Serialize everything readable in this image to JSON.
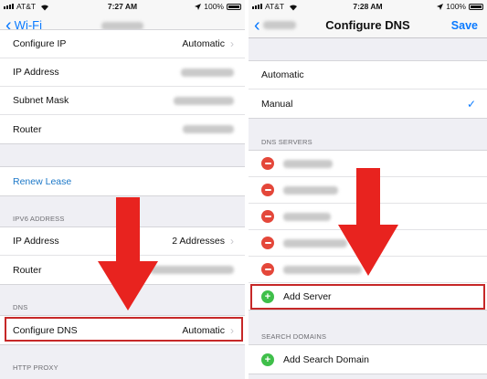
{
  "left": {
    "status": {
      "carrier": "AT&T",
      "time": "7:27 AM",
      "battery": "100%"
    },
    "nav": {
      "back_label": "Wi-Fi"
    },
    "rows_top": [
      {
        "label": "Configure IP",
        "value": "Automatic",
        "chevron": "›"
      },
      {
        "label": "IP Address"
      },
      {
        "label": "Subnet Mask"
      },
      {
        "label": "Router"
      }
    ],
    "renew": {
      "label": "Renew Lease"
    },
    "ipv6": {
      "header": "IPV6 ADDRESS",
      "rows": [
        {
          "label": "IP Address",
          "value": "2 Addresses",
          "chevron": "›"
        },
        {
          "label": "Router"
        }
      ]
    },
    "dns": {
      "header": "DNS",
      "row": {
        "label": "Configure DNS",
        "value": "Automatic",
        "chevron": "›"
      }
    },
    "proxy": {
      "header": "HTTP PROXY"
    }
  },
  "right": {
    "status": {
      "carrier": "AT&T",
      "time": "7:28 AM",
      "battery": "100%"
    },
    "nav": {
      "title": "Configure DNS",
      "save_label": "Save"
    },
    "modes": [
      {
        "label": "Automatic"
      },
      {
        "label": "Manual",
        "check": "✓"
      }
    ],
    "dns_servers": {
      "header": "DNS SERVERS",
      "count": 5,
      "add_label": "Add Server"
    },
    "search_domains": {
      "header": "SEARCH DOMAINS",
      "add_label": "Add Search Domain"
    }
  },
  "colors": {
    "accent": "#0a7aff",
    "link": "#1c78c8",
    "delete": "#e4473a",
    "add": "#3fbf4a",
    "arrow": "#e8231f",
    "highlight": "#c62828"
  },
  "icons": [
    "wifi-icon",
    "battery-icon",
    "location-icon",
    "chevron-left-icon",
    "chevron-right-icon",
    "minus-circle-icon",
    "plus-circle-icon",
    "checkmark-icon",
    "red-arrow-icon"
  ]
}
